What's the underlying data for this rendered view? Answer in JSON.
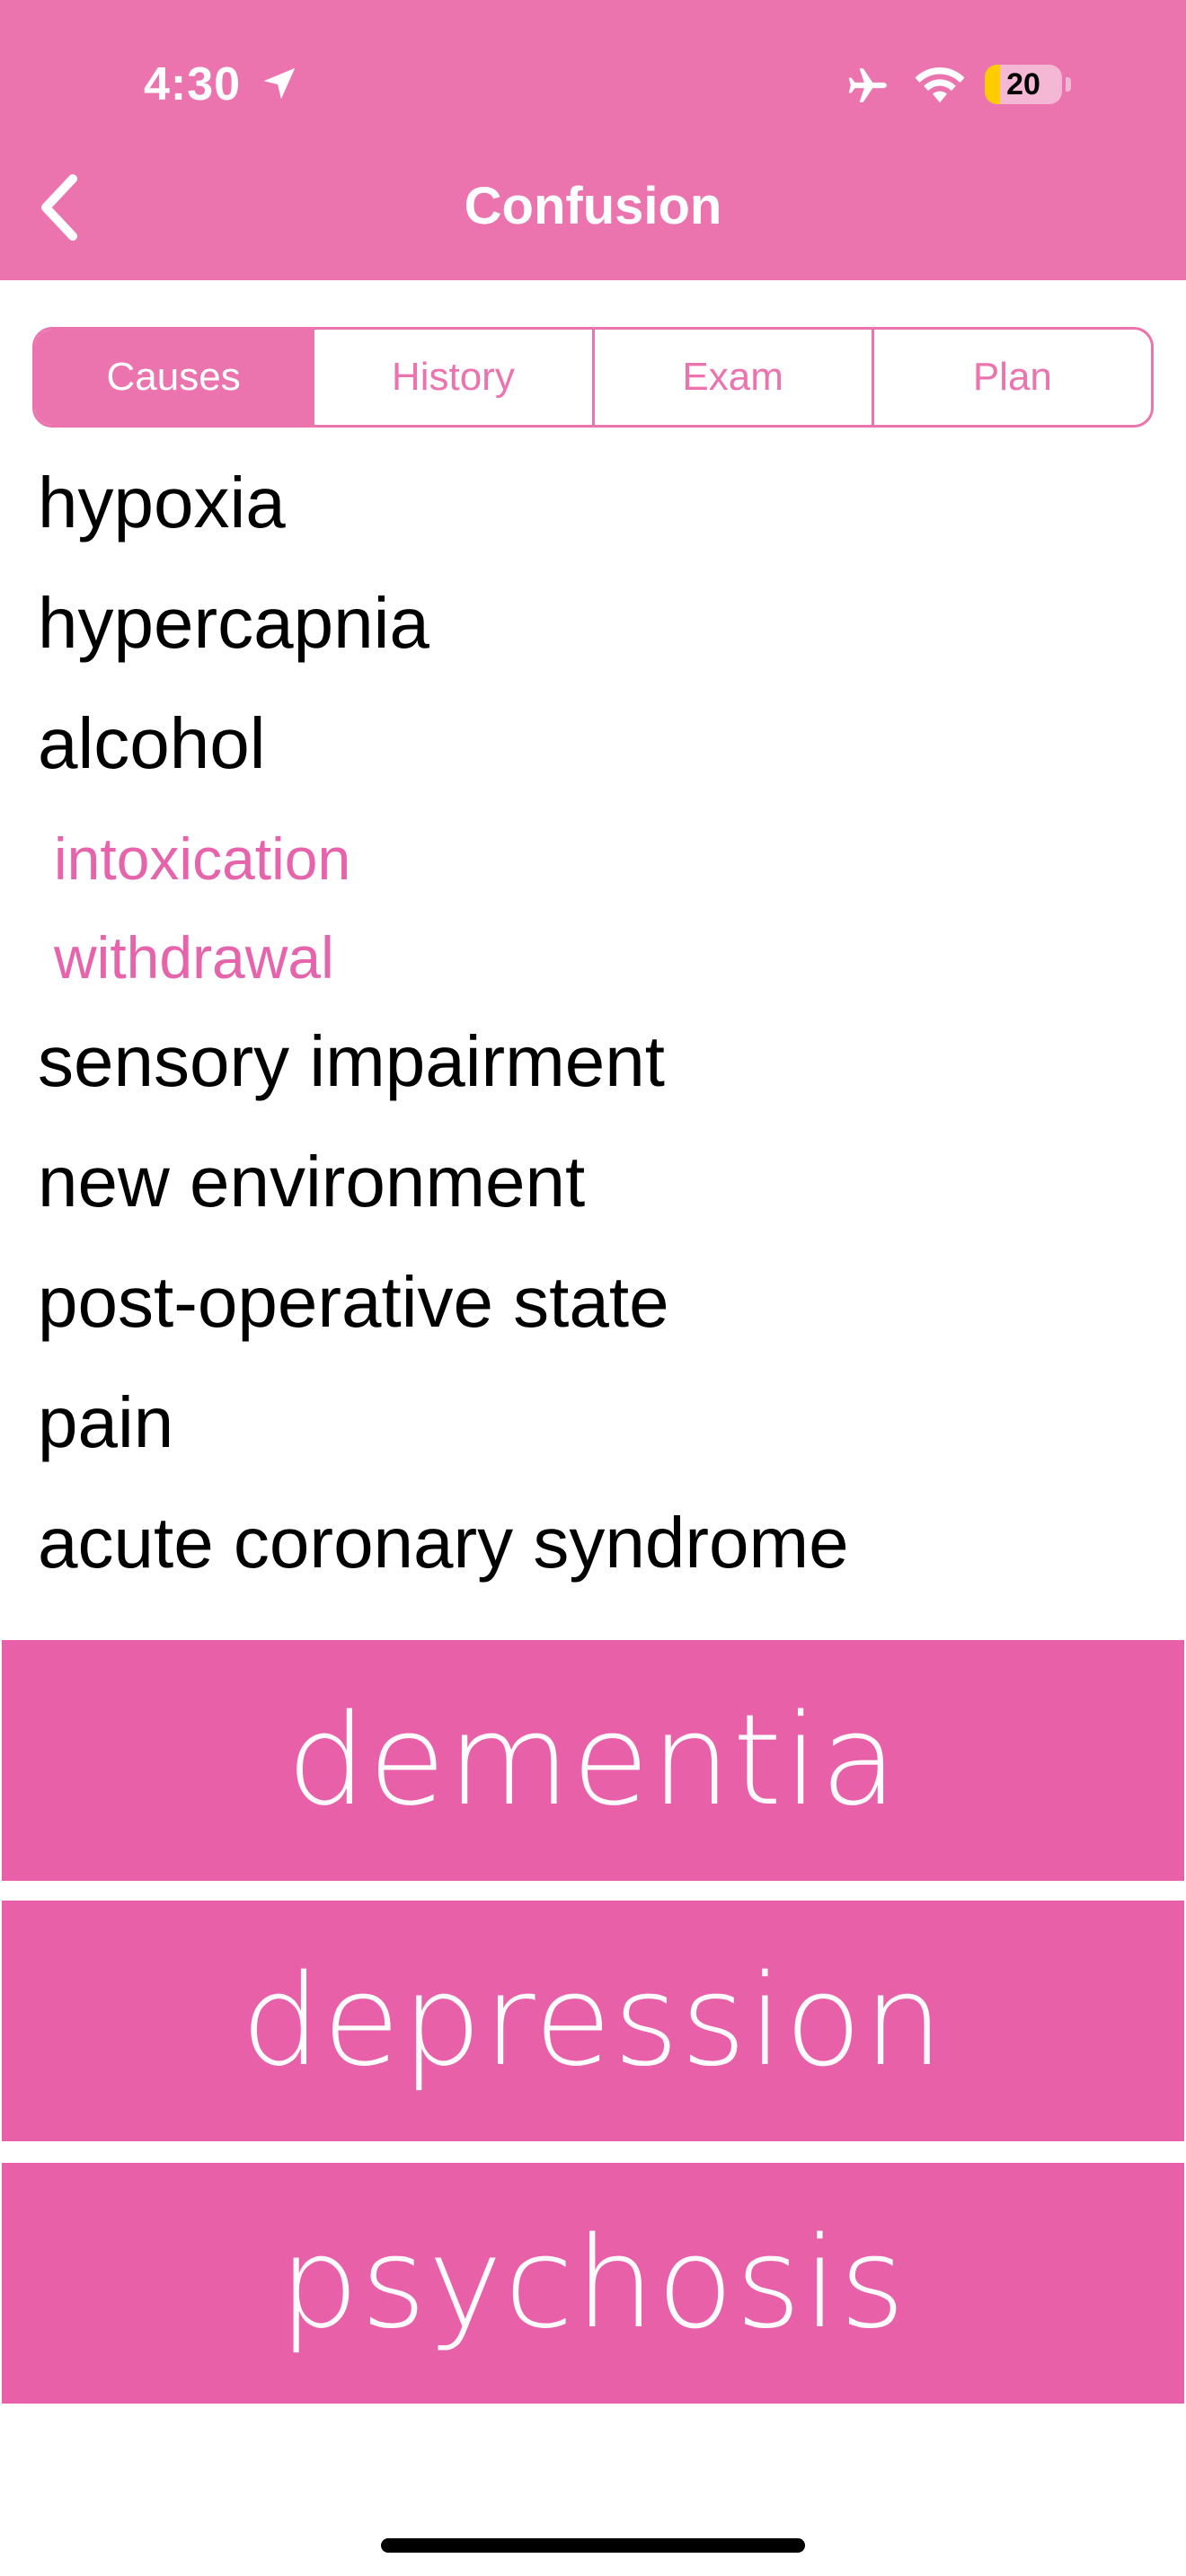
{
  "status_bar": {
    "time": "4:30",
    "battery": "20",
    "battery_level": 0.2
  },
  "nav": {
    "title": "Confusion",
    "back_icon": "chevron-left-icon"
  },
  "tabs": [
    {
      "label": "Causes",
      "active": true
    },
    {
      "label": "History",
      "active": false
    },
    {
      "label": "Exam",
      "active": false
    },
    {
      "label": "Plan",
      "active": false
    }
  ],
  "causes": {
    "items": [
      "hypoxia",
      "hypercapnia",
      "alcohol",
      "intoxication",
      "withdrawal",
      "sensory impairment",
      "new environment",
      "post-operative state",
      "pain",
      "acute coronary syndrome"
    ]
  },
  "buttons": {
    "dementia": "dementia",
    "depression": "depression",
    "psychosis": "psychosis"
  },
  "colors": {
    "header": "#EC74AE",
    "accent": "#EC74AE",
    "subcause_text": "#E664AC",
    "button_bg": "#E760A8",
    "battery_fill": "#FFCC00"
  }
}
